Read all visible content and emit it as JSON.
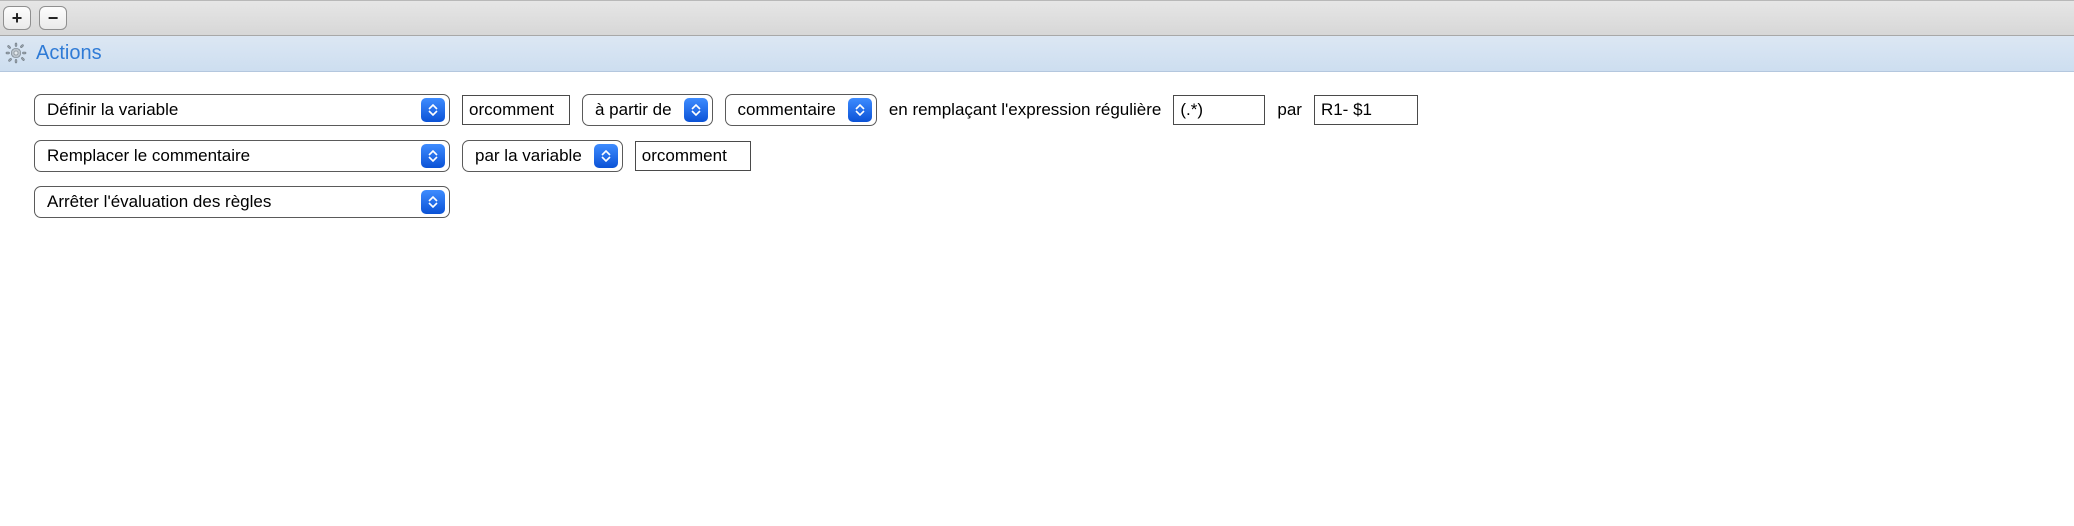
{
  "toolbar": {
    "add_label": "+",
    "remove_label": "−"
  },
  "section": {
    "title": "Actions"
  },
  "row1": {
    "action": "Définir la variable",
    "var_name": "orcomment",
    "from_label": "à partir de",
    "source": "commentaire",
    "replace_label": "en remplaçant l'expression régulière",
    "regex": "(.*)",
    "by_label": "par",
    "replacement": "R1- $1"
  },
  "row2": {
    "action": "Remplacer le commentaire",
    "mode": "par la variable",
    "var_name": "orcomment"
  },
  "row3": {
    "action": "Arrêter l'évaluation des règles"
  }
}
